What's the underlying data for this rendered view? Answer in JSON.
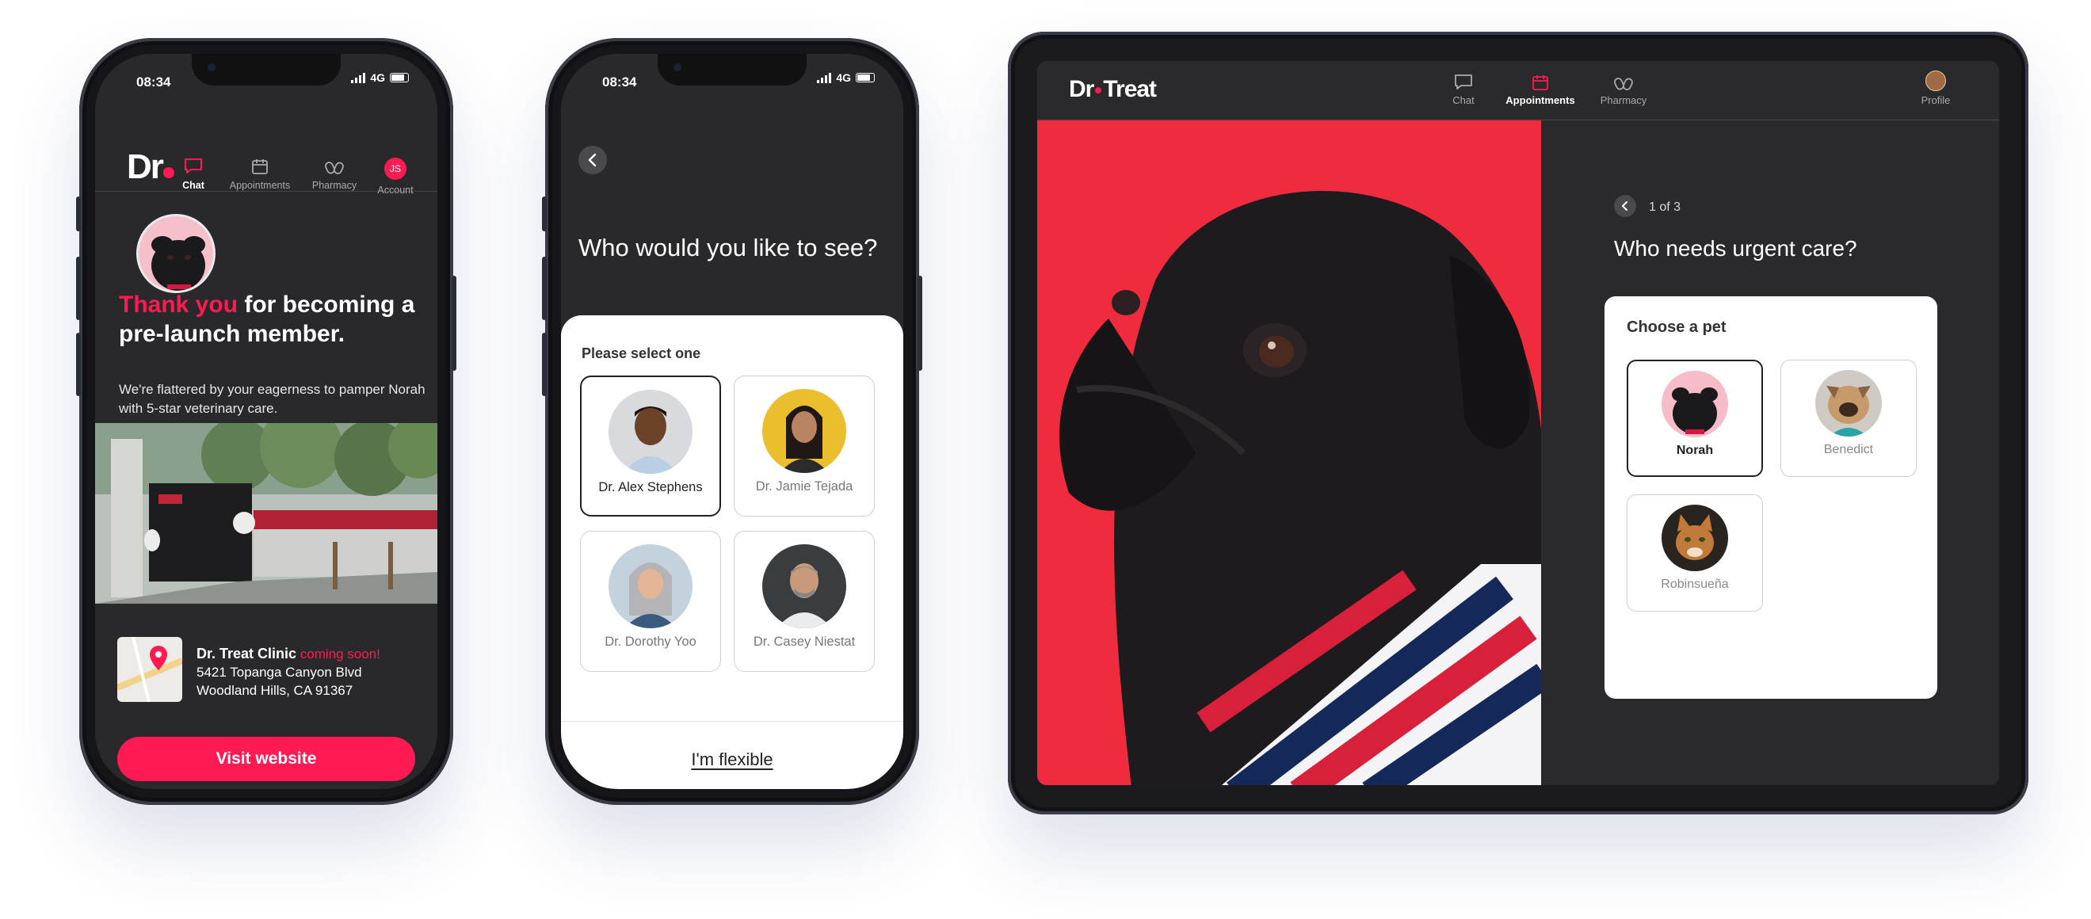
{
  "brand": {
    "accent": "#ff1a53",
    "dark_bg": "#29292b"
  },
  "phone1": {
    "status": {
      "time": "08:34",
      "network": "4G"
    },
    "logo": "Dr",
    "nav": [
      {
        "label": "Chat",
        "icon": "chat-icon",
        "active": true
      },
      {
        "label": "Appointments",
        "icon": "calendar-icon",
        "active": false
      },
      {
        "label": "Pharmacy",
        "icon": "pills-icon",
        "active": false
      },
      {
        "label": "Account",
        "icon": "avatar-initials",
        "initials": "JS",
        "active": false
      }
    ],
    "headline_highlight": "Thank you",
    "headline_rest": " for becoming a pre-launch member.",
    "subtext": "We're flattered by your eagerness to pamper Norah with 5-star veterinary care.",
    "clinic": {
      "name": "Dr. Treat Clinic",
      "status": "coming soon!",
      "address_line1": "5421 Topanga Canyon Blvd",
      "address_line2": "Woodland Hills, CA 91367"
    },
    "cta": "Visit website"
  },
  "phone2": {
    "status": {
      "time": "08:34",
      "network": "4G"
    },
    "question": "Who would you like to see?",
    "card_label": "Please select one",
    "vets": [
      {
        "name": "Dr. Alex Stephens",
        "selected": true
      },
      {
        "name": "Dr. Jamie Tejada",
        "selected": false
      },
      {
        "name": "Dr. Dorothy Yoo",
        "selected": false
      },
      {
        "name": "Dr. Casey Niestat",
        "selected": false
      }
    ],
    "flexible": "I'm flexible"
  },
  "tablet": {
    "logo_left": "Dr",
    "logo_right": "Treat",
    "nav": [
      {
        "label": "Chat",
        "icon": "chat-icon",
        "active": false
      },
      {
        "label": "Appointments",
        "icon": "calendar-icon",
        "active": true
      },
      {
        "label": "Pharmacy",
        "icon": "pills-icon",
        "active": false
      }
    ],
    "profile_label": "Profile",
    "step": "1 of 3",
    "question": "Who needs urgent care?",
    "card_label": "Choose a pet",
    "pets": [
      {
        "name": "Norah",
        "selected": true
      },
      {
        "name": "Benedict",
        "selected": false
      },
      {
        "name": "Robinsueña",
        "selected": false
      }
    ]
  }
}
